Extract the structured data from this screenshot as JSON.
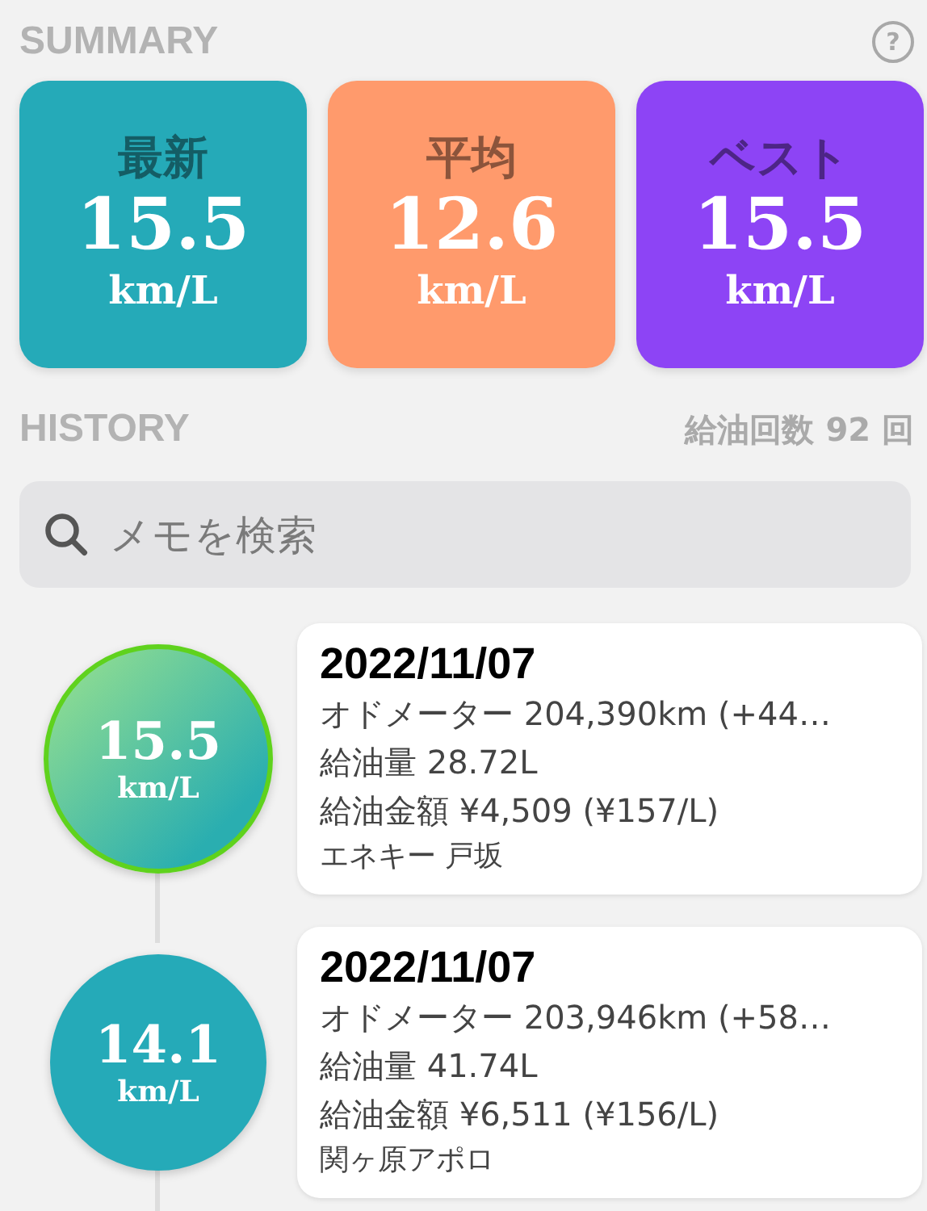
{
  "summary": {
    "title": "SUMMARY",
    "help_icon": "?",
    "cards": [
      {
        "label": "最新",
        "value": "15.5",
        "unit": "km/L",
        "color": "#25aab8"
      },
      {
        "label": "平均",
        "value": "12.6",
        "unit": "km/L",
        "color": "#ff9a6c"
      },
      {
        "label": "ベスト",
        "value": "15.5",
        "unit": "km/L",
        "color": "#8d44f5"
      }
    ]
  },
  "history": {
    "title": "HISTORY",
    "count": "給油回数 92 回",
    "search": {
      "placeholder": "メモを検索"
    },
    "entries": [
      {
        "value": "15.5",
        "unit": "km/L",
        "highlighted": true,
        "date": "2022/11/07",
        "odometer": "オドメーター 204,390km (+44…",
        "amount": "給油量 28.72L",
        "price": "給油金額 ¥4,509 (¥157/L)",
        "station": "エネキー 戸坂"
      },
      {
        "value": "14.1",
        "unit": "km/L",
        "highlighted": false,
        "date": "2022/11/07",
        "odometer": "オドメーター 203,946km (+58…",
        "amount": "給油量 41.74L",
        "price": "給油金額 ¥6,511 (¥156/L)",
        "station": "関ヶ原アポロ"
      }
    ]
  }
}
